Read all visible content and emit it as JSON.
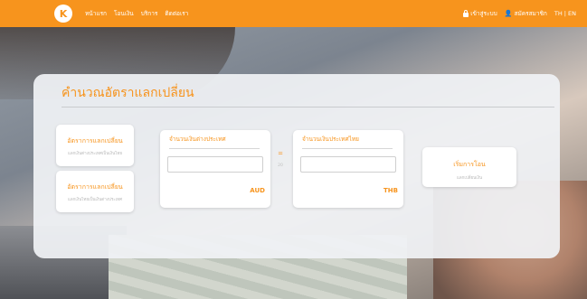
{
  "navbar": {
    "logo_text": "K",
    "links": [
      "หน้าแรก",
      "โอนเงิน",
      "บริการ",
      "ติดต่อเรา"
    ],
    "login_label": "เข้าสู่ระบบ",
    "register_label": "สมัครสมาชิก",
    "language_label": "TH | EN",
    "brand_color": "#f7941d"
  },
  "converter": {
    "title": "คำนวณอัตราแลกเปลี่ยน",
    "rate_buttons": [
      {
        "label": "อัตราการแลกเปลี่ยน",
        "sub": "แลกเงินต่างประเทศเป็นเงินไทย"
      },
      {
        "label": "อัตราการแลกเปลี่ยน",
        "sub": "แลกเงินไทยเป็นเงินต่างประเทศ"
      }
    ],
    "foreign": {
      "label": "จำนวนเงินต่างประเทศ",
      "value": "",
      "currency": "AUD"
    },
    "equals_symbol": "=",
    "equals_sub": "20",
    "thai": {
      "label": "จำนวนเงินประเทศไทย",
      "value": "",
      "currency": "THB"
    },
    "start_button": {
      "label": "เริ่มการโอน",
      "sub": "แลกเปลี่ยนเงิน"
    }
  }
}
